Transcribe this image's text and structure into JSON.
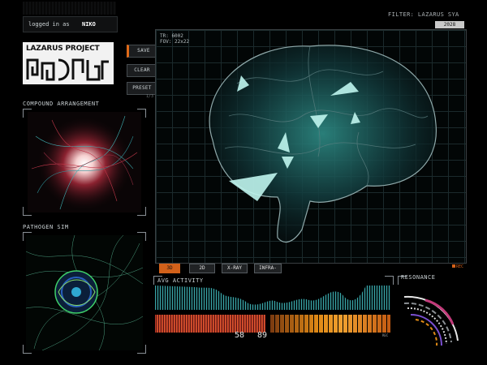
{
  "login": {
    "prefix": "logged in as",
    "user": "NIKO"
  },
  "logo": {
    "text": "LAZARUS PROJECT"
  },
  "buttons": {
    "save": "SAVE",
    "clear": "CLEAR",
    "preset": "PRESET",
    "preset_sub": "1/3"
  },
  "panels": {
    "compound": "COMPOUND ARRANGEMENT",
    "pathogen": "PATHOGEN SIM"
  },
  "viewer": {
    "filter": "FILTER: LAZARUS SYA",
    "year": "2028",
    "info1": "TR: 6002",
    "info2": "FOV: 22x22",
    "tabs": [
      "3D",
      "2D",
      "X-RAY",
      "INFRA-"
    ],
    "active_tab": 0,
    "rec": "REC"
  },
  "activity": {
    "title": "AVG ACTIVITY",
    "rec": "REC",
    "val1": "58",
    "val2": "89"
  },
  "resonance": {
    "title": "RESONANCE"
  },
  "colors": {
    "accent": "#d2611a",
    "teal": "#3fb0b3",
    "red": "#c0392b",
    "orange": "#e08a16"
  }
}
